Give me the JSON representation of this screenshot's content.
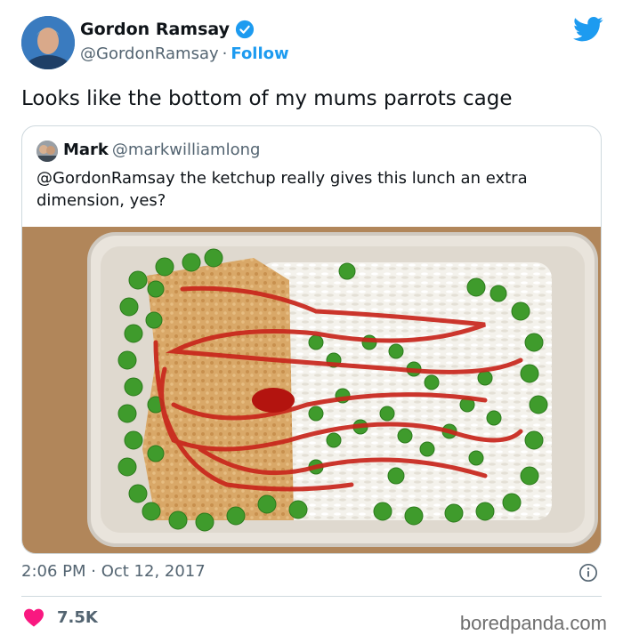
{
  "tweet": {
    "author_name": "Gordon Ramsay",
    "author_handle": "@GordonRamsay",
    "separator": "·",
    "follow_label": "Follow",
    "text": "Looks like the bottom of my mums parrots cage",
    "timestamp": "2:06 PM · Oct 12, 2017",
    "like_count": "7.5K"
  },
  "quoted_tweet": {
    "author_name": "Mark",
    "author_handle": "@markwilliamlong",
    "text": "@GordonRamsay the ketchup really gives this lunch an extra dimension, yes?"
  },
  "watermark": "boredpanda.com",
  "icons": {
    "verified": "verified-badge-icon",
    "brand": "twitter-bird-icon",
    "info": "info-icon",
    "like": "heart-icon"
  },
  "colors": {
    "accent": "#1d9bf0",
    "like": "#f91880",
    "secondary_text": "#536471",
    "border": "#cfd9de"
  }
}
